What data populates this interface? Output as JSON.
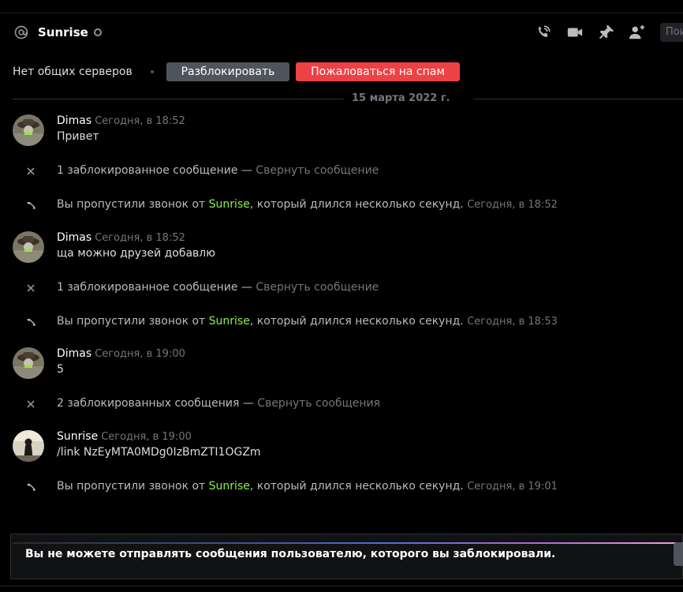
{
  "header": {
    "username": "Sunrise",
    "search_placeholder": "Пои"
  },
  "block_bar": {
    "no_servers": "Нет общих серверов",
    "unblock_label": "Разблокировать",
    "spam_label": "Пожаловаться на спам"
  },
  "date_divider": "15 марта 2022 г.",
  "messages": [
    {
      "author": "Dimas",
      "timestamp": "Сегодня, в 18:52",
      "text": "Привет"
    },
    {
      "author": "Dimas",
      "timestamp": "Сегодня, в 18:52",
      "text": "ща можно друзей добавлю"
    },
    {
      "author": "Dimas",
      "timestamp": "Сегодня, в 19:00",
      "text": "5"
    },
    {
      "author": "Sunrise",
      "timestamp": "Сегодня, в 19:00",
      "text": "/link NzEyMTA0MDg0IzBmZTI1OGZm"
    }
  ],
  "blocked": [
    {
      "text": "1 заблокированное сообщение — ",
      "link": "Свернуть сообщение"
    },
    {
      "text": "1 заблокированное сообщение — ",
      "link": "Свернуть сообщение"
    },
    {
      "text": "2 заблокированных сообщения — ",
      "link": "Свернуть сообщения"
    }
  ],
  "calls": [
    {
      "prefix": "Вы пропустили звонок от ",
      "user": "Sunrise",
      "suffix": ", который длился несколько секунд. ",
      "timestamp": "Сегодня, в 18:52"
    },
    {
      "prefix": "Вы пропустили звонок от ",
      "user": "Sunrise",
      "suffix": ", который длился несколько секунд. ",
      "timestamp": "Сегодня, в 18:53"
    },
    {
      "prefix": "Вы пропустили звонок от ",
      "user": "Sunrise",
      "suffix": ", который длился несколько секунд. ",
      "timestamp": "Сегодня, в 19:01"
    }
  ],
  "composer": {
    "blocked_notice": "Вы не можете отправлять сообщения пользователю, которого вы заблокировали."
  },
  "colors": {
    "accent_red": "#ed4245",
    "button_grey": "#4f545c",
    "mention_green": "#8df24c"
  }
}
